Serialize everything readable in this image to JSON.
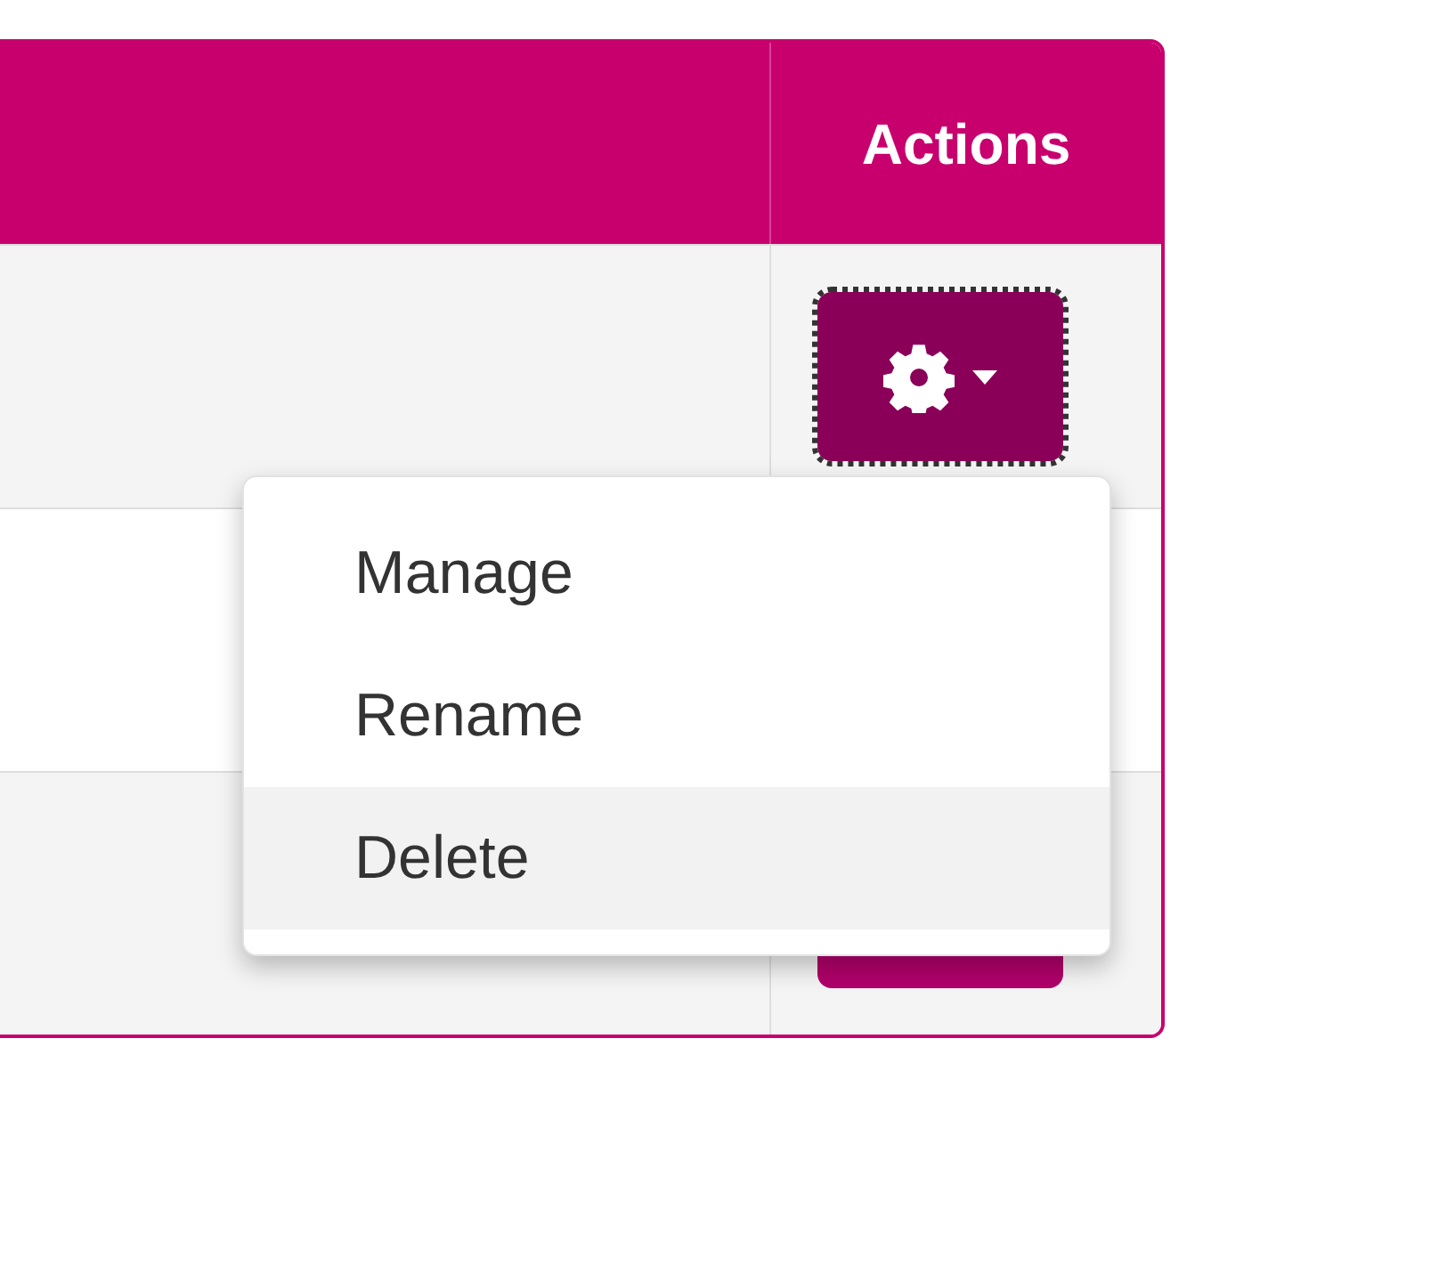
{
  "table": {
    "columns": [
      {
        "label": "Actions"
      }
    ],
    "rows": [
      {
        "kind": "button",
        "button_focused": true
      },
      {
        "kind": "plain"
      },
      {
        "kind": "covered-button",
        "button_focused": false
      }
    ]
  },
  "menu": {
    "items": [
      {
        "label": "Manage",
        "selected": false
      },
      {
        "label": "Rename",
        "selected": false
      },
      {
        "label": "Delete",
        "selected": true
      }
    ]
  }
}
